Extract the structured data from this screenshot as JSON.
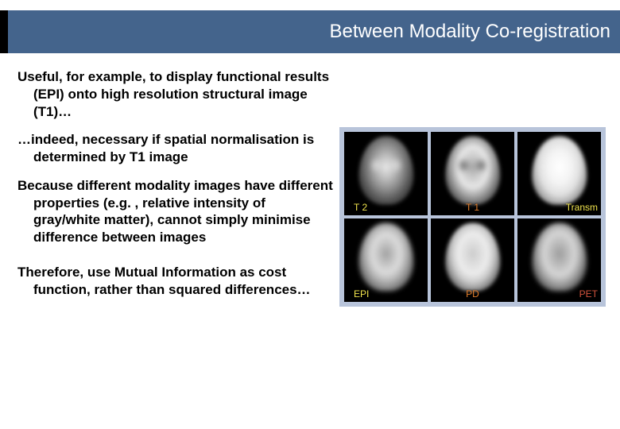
{
  "header": {
    "title": "Between Modality Co-registration"
  },
  "paragraphs": {
    "p1": "Useful, for example, to display functional results (EPI) onto high resolution structural image (T1)…",
    "p2": "…indeed, necessary if spatial normalisation is determined by T1 image",
    "p3": "Because different modality images have different properties (e.g. , relative intensity of gray/white matter), cannot simply minimise difference between images",
    "p4": "Therefore, use Mutual Information as cost function, rather than squared differences…"
  },
  "modalities": {
    "r1c1": "T 2",
    "r1c2": "T 1",
    "r1c3": "Transm",
    "r2c1": "EPI",
    "r2c2": "PD",
    "r2c3": "PET"
  }
}
